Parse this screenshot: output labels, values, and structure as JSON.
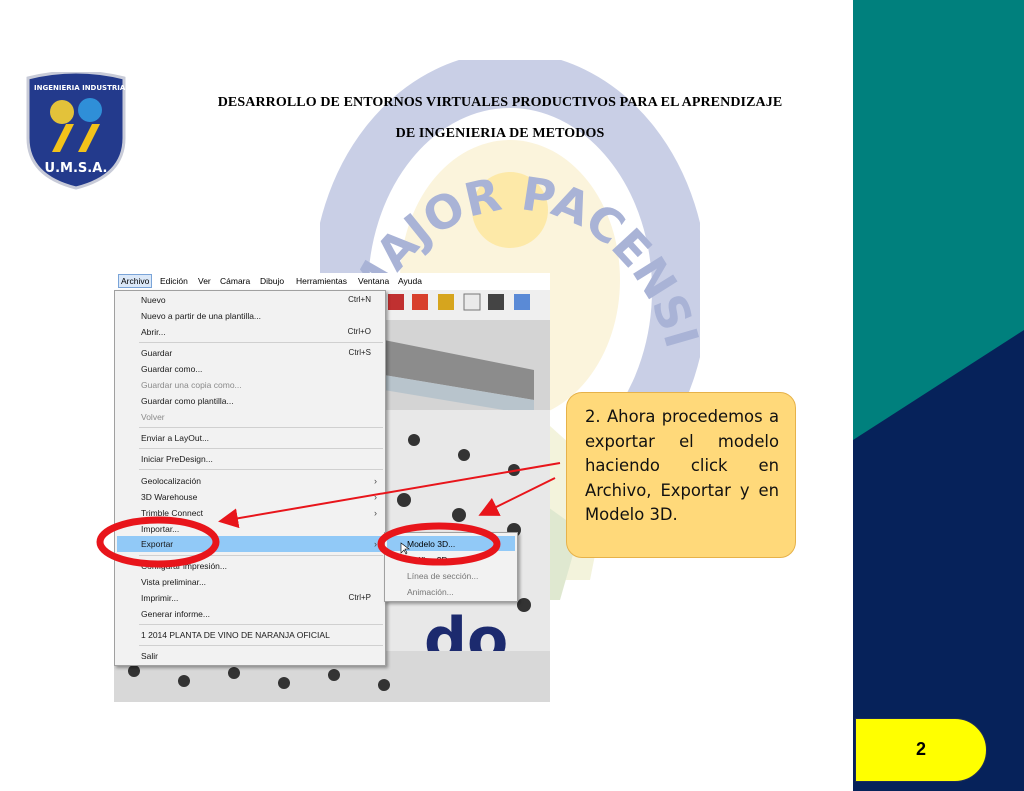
{
  "header": {
    "title_line1": "DESARROLLO DE ENTORNOS VIRTUALES PRODUCTIVOS PARA EL APRENDIZAJE",
    "title_line2": "DE INGENIERIA DE METODOS"
  },
  "logo": {
    "arc_text": "INGENIERIA INDUSTRIAL",
    "bottom_text": "U.M.S.A."
  },
  "seal": {
    "ring_text": "S MAJOR PACENSIS DIVI AN"
  },
  "menubar": {
    "items": [
      "Archivo",
      "Edición",
      "Ver",
      "Cámara",
      "Dibujo",
      "Herramientas",
      "Ventana",
      "Ayuda"
    ]
  },
  "menu": {
    "nuevo": "Nuevo",
    "nuevo_sc": "Ctrl+N",
    "plantilla": "Nuevo a partir de una plantilla...",
    "abrir": "Abrir...",
    "abrir_sc": "Ctrl+O",
    "guardar": "Guardar",
    "guardar_sc": "Ctrl+S",
    "guardar_como": "Guardar como...",
    "guardar_copia": "Guardar una copia como...",
    "guardar_plantilla": "Guardar como plantilla...",
    "volver": "Volver",
    "layout": "Enviar a LayOut...",
    "predesign": "Iniciar PreDesign...",
    "geolocalizacion": "Geolocalización",
    "warehouse": "3D Warehouse",
    "trimble": "Trimble Connect",
    "importar": "Importar...",
    "exportar": "Exportar",
    "configurar": "Configurar impresión...",
    "vista": "Vista preliminar...",
    "imprimir": "Imprimir...",
    "imprimir_sc": "Ctrl+P",
    "informe": "Generar informe...",
    "reciente": "1 2014 PLANTA DE VINO DE NARANJA OFICIAL",
    "salir": "Salir"
  },
  "submenu": {
    "modelo3d": "Modelo 3D...",
    "grafico": "Gráfico 2D...",
    "seccion": "Línea de sección...",
    "animacion": "Animación..."
  },
  "callout": {
    "text": "2. Ahora procedemos a exportar el modelo haciendo click en Archivo, Exportar y en Modelo 3D."
  },
  "page": {
    "number": "2"
  },
  "colors": {
    "teal": "#00807d",
    "navy": "#06225a",
    "callout_fill": "#ffd97a",
    "badge_fill": "#ffff00",
    "highlight_red": "#e8151b",
    "menu_highlight": "#91c9f7"
  }
}
